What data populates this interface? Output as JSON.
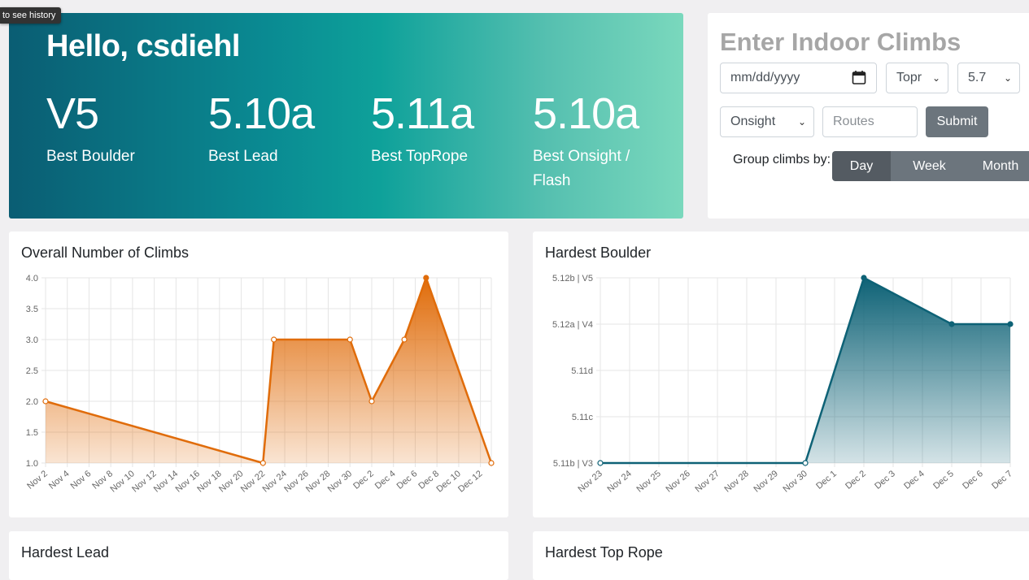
{
  "tooltip": "to see history",
  "hero": {
    "greeting": "Hello, csdiehl",
    "stats": [
      {
        "value": "V5",
        "label": "Best Boulder"
      },
      {
        "value": "5.10a",
        "label": "Best Lead"
      },
      {
        "value": "5.11a",
        "label": "Best TopRope"
      },
      {
        "value": "5.10a",
        "label": "Best Onsight / Flash"
      }
    ]
  },
  "form": {
    "title": "Enter Indoor Climbs",
    "date_placeholder": "mm/dd/yyyy",
    "type_value": "Topr",
    "grade_value": "5.7",
    "style_value": "Onsight",
    "routes_placeholder": "Routes",
    "submit_label": "Submit",
    "group_label": "Group climbs by:",
    "group_options": [
      "Day",
      "Week",
      "Month"
    ],
    "group_selected": "Day"
  },
  "colors": {
    "orange": "#e06c0a",
    "teal": "#0e6276"
  },
  "charts": [
    {
      "title": "Overall Number of Climbs",
      "chart_data": {
        "type": "area",
        "x": [
          "Nov 2",
          "Nov 4",
          "Nov 6",
          "Nov 8",
          "Nov 10",
          "Nov 12",
          "Nov 14",
          "Nov 16",
          "Nov 18",
          "Nov 20",
          "Nov 22",
          "Nov 24",
          "Nov 26",
          "Nov 28",
          "Nov 30",
          "Dec 2",
          "Dec 4",
          "Dec 6",
          "Dec 8",
          "Dec 10",
          "Dec 12"
        ],
        "points": [
          {
            "date": "Nov 2",
            "y": 2.0
          },
          {
            "date": "Nov 22",
            "y": 1.0
          },
          {
            "date": "Nov 23",
            "y": 3.0
          },
          {
            "date": "Nov 30",
            "y": 3.0
          },
          {
            "date": "Dec 2",
            "y": 2.0
          },
          {
            "date": "Dec 5",
            "y": 3.0
          },
          {
            "date": "Dec 7",
            "y": 4.0
          },
          {
            "date": "Dec 13",
            "y": 1.0
          }
        ],
        "y_ticks": [
          "4.0",
          "3.5",
          "3.0",
          "2.5",
          "2.0",
          "1.5",
          "1.0"
        ],
        "ylim": [
          1.0,
          4.0
        ],
        "grid": true
      }
    },
    {
      "title": "Hardest Boulder",
      "chart_data": {
        "type": "area",
        "x": [
          "Nov 23",
          "Nov 24",
          "Nov 25",
          "Nov 26",
          "Nov 27",
          "Nov 28",
          "Nov 29",
          "Nov 30",
          "Dec 1",
          "Dec 2",
          "Dec 3",
          "Dec 4",
          "Dec 5",
          "Dec 6",
          "Dec 7"
        ],
        "points": [
          {
            "date": "Nov 23",
            "y": "5.11b | V3"
          },
          {
            "date": "Nov 30",
            "y": "5.11b | V3"
          },
          {
            "date": "Dec 2",
            "y": "5.12b | V5"
          },
          {
            "date": "Dec 5",
            "y": "5.12a | V4"
          },
          {
            "date": "Dec 7",
            "y": "5.12a | V4"
          }
        ],
        "y_ticks": [
          "5.12b | V5",
          "5.12a | V4",
          "5.11d",
          "5.11c",
          "5.11b | V3"
        ],
        "grid": true
      }
    }
  ],
  "bottom_cards": [
    "Hardest Lead",
    "Hardest Top Rope"
  ]
}
